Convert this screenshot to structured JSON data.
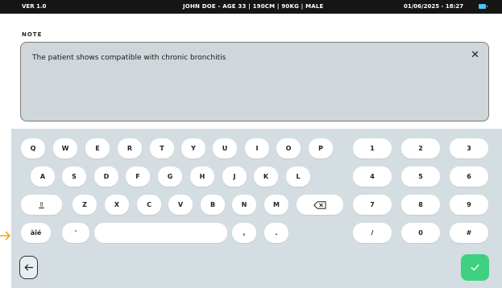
{
  "status_bar": {
    "version": "VER 1.0",
    "patient_info": "JOHN DOE - AGE 33 | 190CM | 90KG | MALE",
    "datetime": "01/06/2025 - 18:27",
    "battery_icon": "battery-icon"
  },
  "note": {
    "label": "NOTE",
    "text": "The patient shows compatible with chronic bronchitis",
    "close_glyph": "✕"
  },
  "keyboard": {
    "row1": [
      "Q",
      "W",
      "E",
      "R",
      "T",
      "Y",
      "U",
      "I",
      "O",
      "P"
    ],
    "row2": [
      "A",
      "S",
      "D",
      "F",
      "G",
      "H",
      "J",
      "K",
      "L"
    ],
    "row3": [
      "Z",
      "X",
      "C",
      "V",
      "B",
      "N",
      "M"
    ],
    "shift_label": "⇧",
    "accent_label": "àîé",
    "apostrophe_label": "'",
    "comma_label": ",",
    "period_label": ".",
    "numpad": [
      [
        "1",
        "2",
        "3"
      ],
      [
        "4",
        "5",
        "6"
      ],
      [
        "7",
        "8",
        "9"
      ],
      [
        "/",
        "0",
        "#"
      ]
    ]
  },
  "colors": {
    "status_bar_bg": "#151515",
    "keyboard_bg": "#d4dde1",
    "confirm_green": "#3fd081",
    "battery_blue": "#4fc3f7",
    "arrow_orange": "#f5a623"
  },
  "icons": {
    "backspace": "backspace-icon",
    "back": "arrow-left-icon",
    "confirm": "checkmark-icon"
  }
}
